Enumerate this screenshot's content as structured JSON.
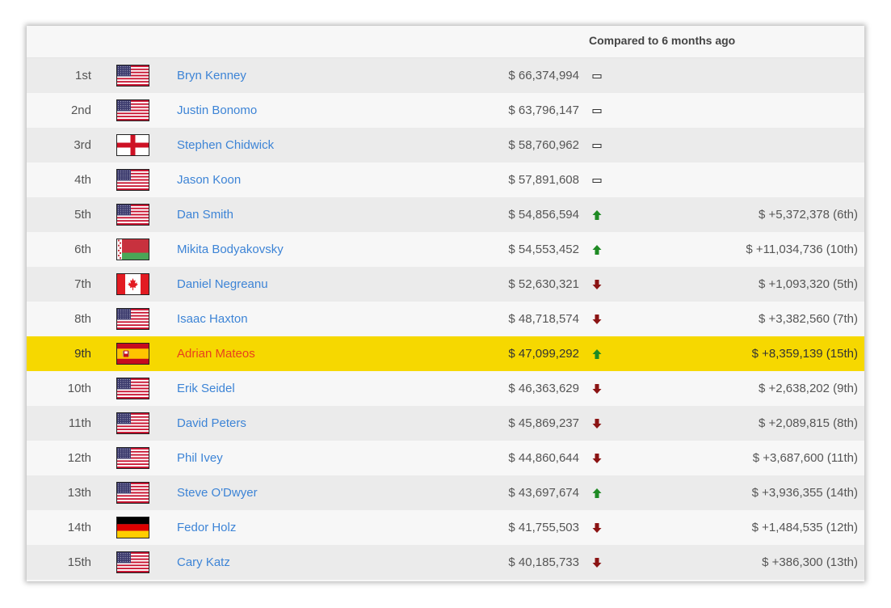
{
  "header": {
    "compared_label": "Compared to 6 months ago"
  },
  "colors": {
    "link": "#3d84d6",
    "highlight_bg": "#f6d800",
    "highlight_text": "#e8411c",
    "up": "#1f8a24",
    "down": "#8b1414",
    "same": "#333333"
  },
  "rows": [
    {
      "rank": "1st",
      "country": "us-flag",
      "name": "Bryn Kenney",
      "earnings": "$ 66,374,994",
      "trend": "same",
      "change": ""
    },
    {
      "rank": "2nd",
      "country": "us-flag",
      "name": "Justin Bonomo",
      "earnings": "$ 63,796,147",
      "trend": "same",
      "change": ""
    },
    {
      "rank": "3rd",
      "country": "england-flag",
      "name": "Stephen Chidwick",
      "earnings": "$ 58,760,962",
      "trend": "same",
      "change": ""
    },
    {
      "rank": "4th",
      "country": "us-flag",
      "name": "Jason Koon",
      "earnings": "$ 57,891,608",
      "trend": "same",
      "change": ""
    },
    {
      "rank": "5th",
      "country": "us-flag",
      "name": "Dan Smith",
      "earnings": "$ 54,856,594",
      "trend": "up",
      "change": "$ +5,372,378 (6th)"
    },
    {
      "rank": "6th",
      "country": "belarus-flag",
      "name": "Mikita Bodyakovsky",
      "earnings": "$ 54,553,452",
      "trend": "up",
      "change": "$ +11,034,736 (10th)"
    },
    {
      "rank": "7th",
      "country": "canada-flag",
      "name": "Daniel Negreanu",
      "earnings": "$ 52,630,321",
      "trend": "down",
      "change": "$ +1,093,320 (5th)"
    },
    {
      "rank": "8th",
      "country": "us-flag",
      "name": "Isaac Haxton",
      "earnings": "$ 48,718,574",
      "trend": "down",
      "change": "$ +3,382,560 (7th)"
    },
    {
      "rank": "9th",
      "country": "spain-flag",
      "name": "Adrian Mateos",
      "earnings": "$ 47,099,292",
      "trend": "up",
      "change": "$ +8,359,139 (15th)",
      "highlight": true
    },
    {
      "rank": "10th",
      "country": "us-flag",
      "name": "Erik Seidel",
      "earnings": "$ 46,363,629",
      "trend": "down",
      "change": "$ +2,638,202 (9th)"
    },
    {
      "rank": "11th",
      "country": "us-flag",
      "name": "David Peters",
      "earnings": "$ 45,869,237",
      "trend": "down",
      "change": "$ +2,089,815 (8th)"
    },
    {
      "rank": "12th",
      "country": "us-flag",
      "name": "Phil Ivey",
      "earnings": "$ 44,860,644",
      "trend": "down",
      "change": "$ +3,687,600 (11th)"
    },
    {
      "rank": "13th",
      "country": "us-flag",
      "name": "Steve O'Dwyer",
      "earnings": "$ 43,697,674",
      "trend": "up",
      "change": "$ +3,936,355 (14th)"
    },
    {
      "rank": "14th",
      "country": "germany-flag",
      "name": "Fedor Holz",
      "earnings": "$ 41,755,503",
      "trend": "down",
      "change": "$ +1,484,535 (12th)"
    },
    {
      "rank": "15th",
      "country": "us-flag",
      "name": "Cary Katz",
      "earnings": "$ 40,185,733",
      "trend": "down",
      "change": "$ +386,300 (13th)"
    }
  ]
}
